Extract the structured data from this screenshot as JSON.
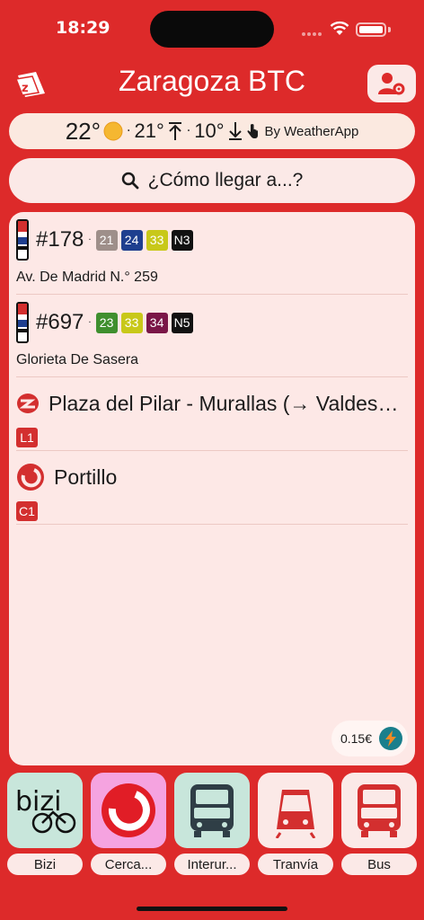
{
  "status": {
    "time": "18:29"
  },
  "header": {
    "title": "Zaragoza BTC"
  },
  "weather": {
    "temp": "22°",
    "sep": "·",
    "max": "21°",
    "min": "10°",
    "by": "By WeatherApp"
  },
  "search": {
    "label": "¿Cómo llegar a...?"
  },
  "stops": [
    {
      "number": "#178",
      "address": "Av. De Madrid N.° 259",
      "lines": [
        {
          "label": "21",
          "color": "#9E8F8A"
        },
        {
          "label": "24",
          "color": "#1E3F8F"
        },
        {
          "label": "33",
          "color": "#C8C819"
        },
        {
          "label": "N3",
          "color": "#111111"
        }
      ]
    },
    {
      "number": "#697",
      "address": "Glorieta De Sasera",
      "lines": [
        {
          "label": "23",
          "color": "#3F8F2E"
        },
        {
          "label": "33",
          "color": "#C8C819"
        },
        {
          "label": "34",
          "color": "#7A1647"
        },
        {
          "label": "N5",
          "color": "#111111"
        }
      ]
    }
  ],
  "lines": [
    {
      "name": "Plaza del Pilar - Murallas (→ Valdespartera)",
      "badge": "L1"
    },
    {
      "name": "Portillo",
      "badge": "C1"
    }
  ],
  "price": {
    "value": "0.15€"
  },
  "nav": [
    {
      "label": "Bizi",
      "bg": "#C8E6DB"
    },
    {
      "label": "Cerca...",
      "bg": "#F5A3E0"
    },
    {
      "label": "Interur...",
      "bg": "#C8E6DB"
    },
    {
      "label": "Tranvía",
      "bg": "#FBE9E7"
    },
    {
      "label": "Bus",
      "bg": "#FBE9E7"
    }
  ],
  "bizi_text": "bizi"
}
